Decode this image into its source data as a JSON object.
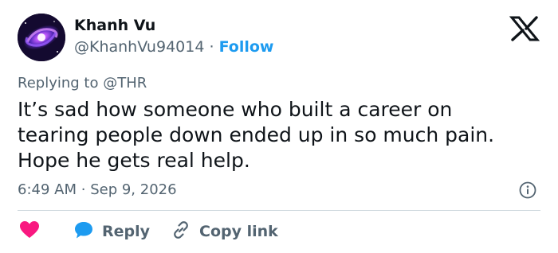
{
  "author": {
    "name": "Khanh Vu",
    "handle": "@KhanhVu94014",
    "separator": "·",
    "follow_label": "Follow"
  },
  "reply_context": {
    "prefix": "Replying to",
    "mention": "@THR"
  },
  "tweet": {
    "text": "It’s sad how someone who built a career on\ntearing people down ended up in so much pain.\nHope he gets real help.",
    "time": "6:49 AM",
    "separator": "·",
    "date": "Sep 9, 2026"
  },
  "actions": {
    "reply_label": "Reply",
    "copy_link_label": "Copy link"
  },
  "icons": {
    "logo": "x-logo-icon",
    "info": "info-icon",
    "like": "heart-icon",
    "reply": "speech-bubble-icon",
    "copy": "link-icon"
  },
  "colors": {
    "accent": "#1d9bf0",
    "heart": "#f91880",
    "muted": "#536471",
    "text": "#0f1419"
  }
}
